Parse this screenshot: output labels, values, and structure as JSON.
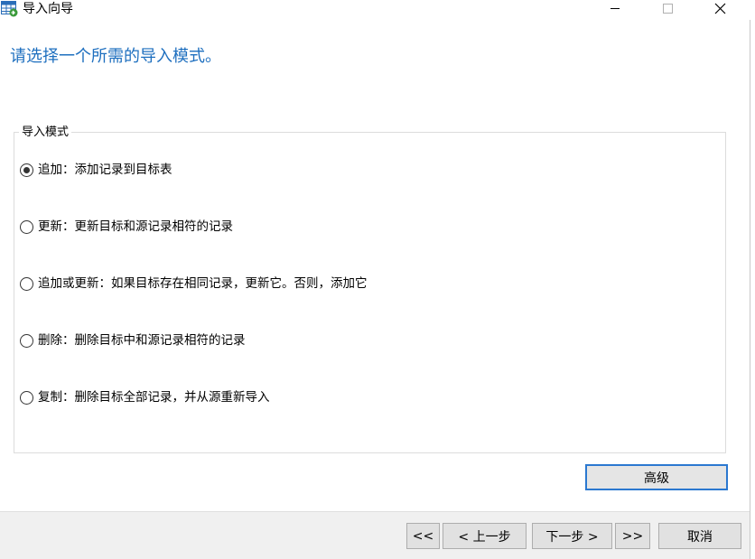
{
  "window": {
    "title": "导入向导",
    "icons": {
      "app": "table-import-icon",
      "minimize": "minimize-icon",
      "maximize": "maximize-icon",
      "close": "close-icon"
    }
  },
  "heading": "请选择一个所需的导入模式。",
  "group": {
    "legend": "导入模式",
    "options": [
      {
        "label": "追加：添加记录到目标表",
        "selected": true
      },
      {
        "label": "更新：更新目标和源记录相符的记录",
        "selected": false
      },
      {
        "label": "追加或更新：如果目标存在相同记录，更新它。否则，添加它",
        "selected": false
      },
      {
        "label": "删除：删除目标中和源记录相符的记录",
        "selected": false
      },
      {
        "label": "复制：删除目标全部记录，并从源重新导入",
        "selected": false
      }
    ]
  },
  "buttons": {
    "advanced": "高级",
    "first": "<<",
    "prev": "< 上一步",
    "next": "下一步 >",
    "last": ">>",
    "cancel": "取消"
  },
  "colors": {
    "heading": "#1e6fbf",
    "focus_border": "#2b78d0"
  }
}
